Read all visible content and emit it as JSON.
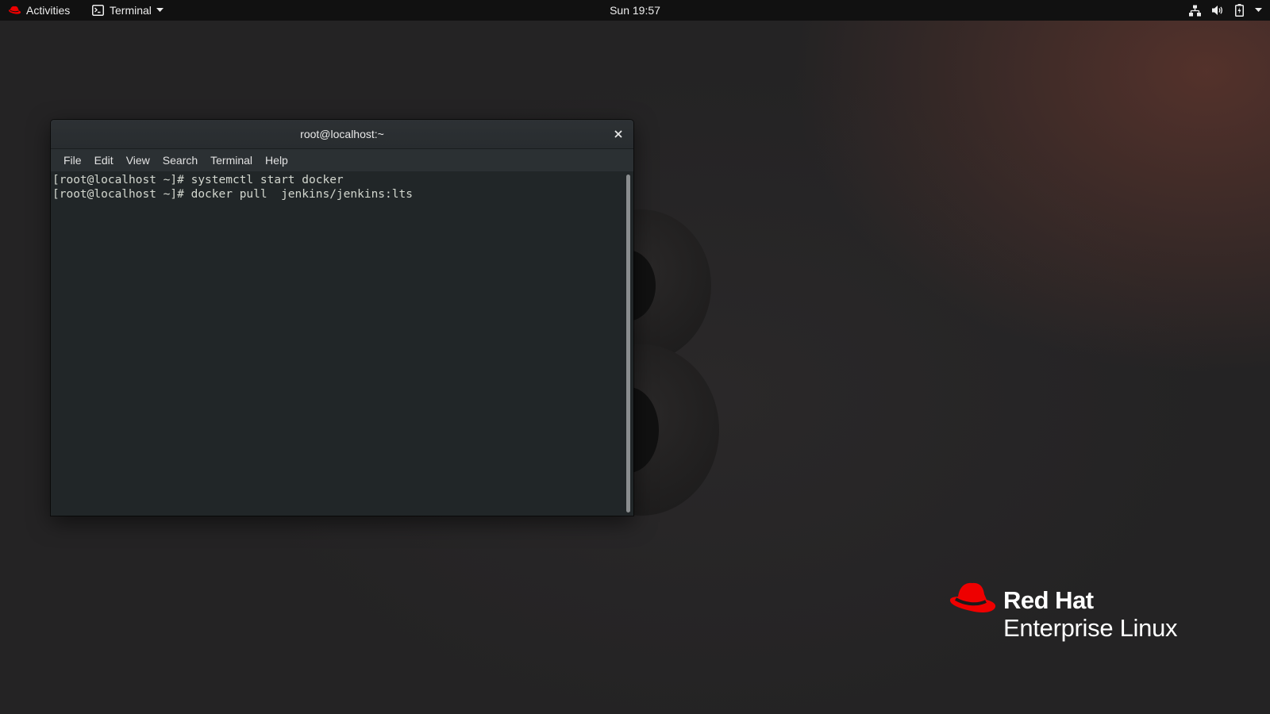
{
  "topbar": {
    "activities_label": "Activities",
    "app_menu_label": "Terminal",
    "clock": "Sun 19:57"
  },
  "terminal": {
    "title": "root@localhost:~",
    "menu": [
      "File",
      "Edit",
      "View",
      "Search",
      "Terminal",
      "Help"
    ],
    "lines": [
      "[root@localhost ~]# systemctl start docker",
      "[root@localhost ~]# docker pull  jenkins/jenkins:lts"
    ]
  },
  "branding": {
    "line1": "Red Hat",
    "line2": "Enterprise Linux"
  },
  "colors": {
    "redhat_red": "#ee0000",
    "terminal_bg": "#212628",
    "topbar_bg": "#111111"
  },
  "icons": {
    "activities": "redhat-hat-icon",
    "app_menu": "terminal-icon",
    "tray": [
      "network-icon",
      "volume-icon",
      "battery-icon",
      "system-menu-caret-icon"
    ]
  }
}
